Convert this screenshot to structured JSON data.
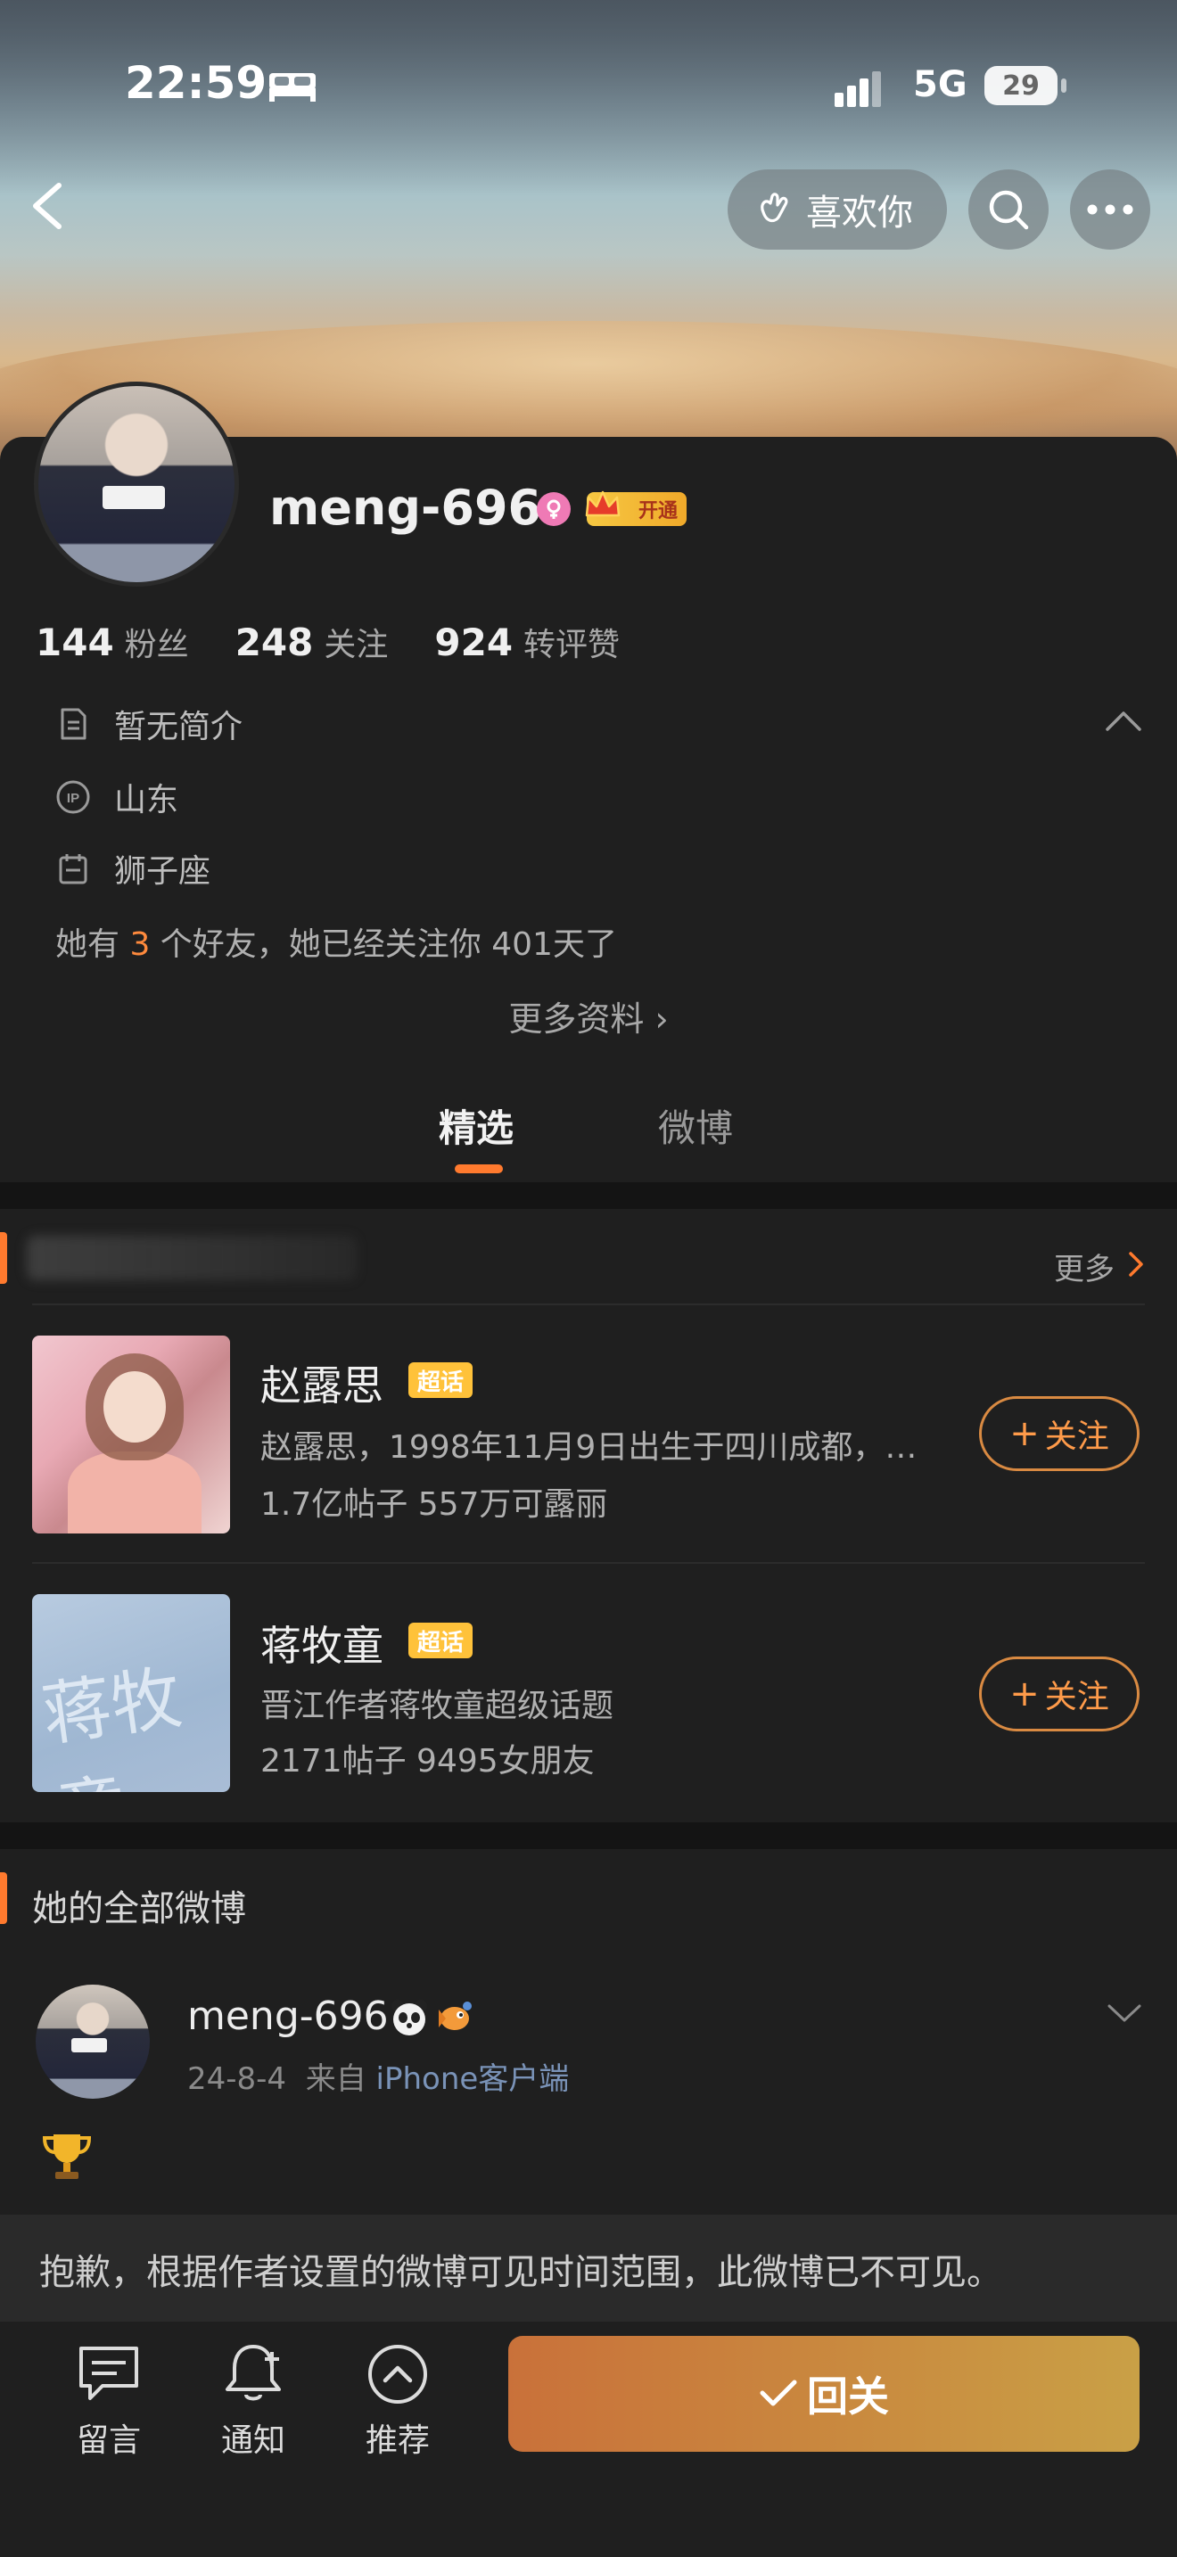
{
  "status_bar": {
    "time": "22:59",
    "network": "5G",
    "battery": "29"
  },
  "header": {
    "like_label": "喜欢你"
  },
  "profile": {
    "username": "meng-696",
    "vip_label": "开通",
    "stats": [
      {
        "num": "144",
        "label": "粉丝"
      },
      {
        "num": "248",
        "label": "关注"
      },
      {
        "num": "924",
        "label": "转评赞"
      }
    ],
    "bio": "暂无简介",
    "ip_location": "山东",
    "zodiac": "狮子座",
    "friends_prefix": "她有 ",
    "friends_count": "3",
    "friends_suffix": " 个好友，她已经关注你 401天了",
    "more_info": "更多资料 ›"
  },
  "tabs": [
    {
      "label": "精选",
      "active": true
    },
    {
      "label": "微博",
      "active": false
    }
  ],
  "super_topics": {
    "more_label": "更多",
    "items": [
      {
        "name": "赵露思",
        "tag": "超话",
        "desc": "赵露思，1998年11月9日出生于四川成都，…",
        "meta": "1.7亿帖子 557万可露丽",
        "follow_label": "关注"
      },
      {
        "name": "蒋牧童",
        "tag": "超话",
        "desc": "晋江作者蒋牧童超级话题",
        "meta": "2171帖子 9495女朋友",
        "follow_label": "关注"
      }
    ]
  },
  "posts": {
    "title": "她的全部微博",
    "items": [
      {
        "author": "meng-696",
        "date": "24-8-4",
        "source_prefix": "来自",
        "source": "iPhone客户端",
        "notice": "抱歉，根据作者设置的微博可见时间范围，此微博已不可见。"
      }
    ]
  },
  "bottom_bar": {
    "message_label": "留言",
    "notify_label": "通知",
    "recommend_label": "推荐",
    "refollow_label": "回关"
  },
  "colors": {
    "accent": "#ff7a2e",
    "card_bg": "#1f1f1f",
    "page_bg": "#141414"
  }
}
